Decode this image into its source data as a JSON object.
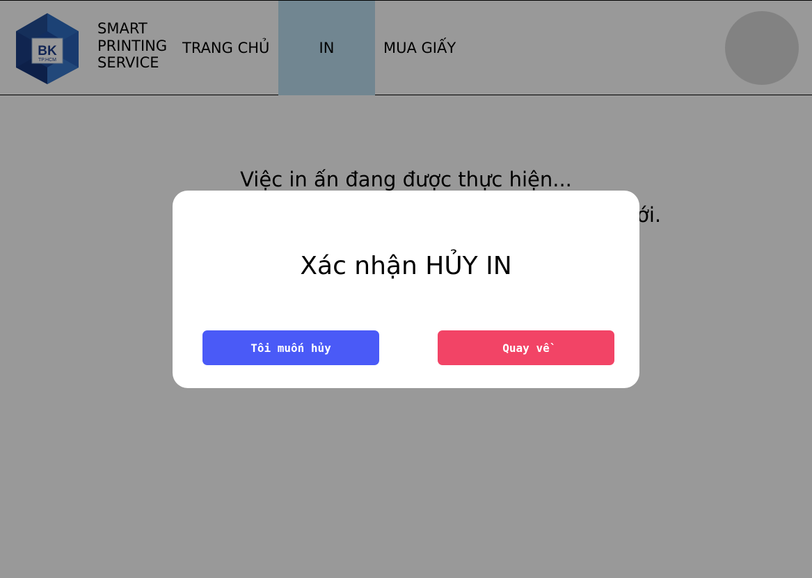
{
  "header": {
    "logo": {
      "text": "BK",
      "subtext": "TP.HCM"
    },
    "brand_lines": [
      "SMART",
      "PRINTING",
      "SERVICE"
    ],
    "nav": [
      {
        "label": "TRANG CHỦ",
        "active": false
      },
      {
        "label": "IN",
        "active": true
      },
      {
        "label": "MUA GIẤY",
        "active": false
      }
    ],
    "active_color": "#bde0f2"
  },
  "main": {
    "status_line_1": "Việc in ấn đang được thực hiện...",
    "status_line_2_visible_tail": "mới."
  },
  "modal": {
    "title": "Xác nhận HỦY IN",
    "confirm_button": {
      "label": "Tôi muốn hủy",
      "color": "#4a5af7"
    },
    "back_button": {
      "label": "Quay về",
      "color": "#f24466"
    }
  },
  "icons": {
    "logo": "bk-hcmut-logo",
    "avatar": "user-avatar"
  }
}
